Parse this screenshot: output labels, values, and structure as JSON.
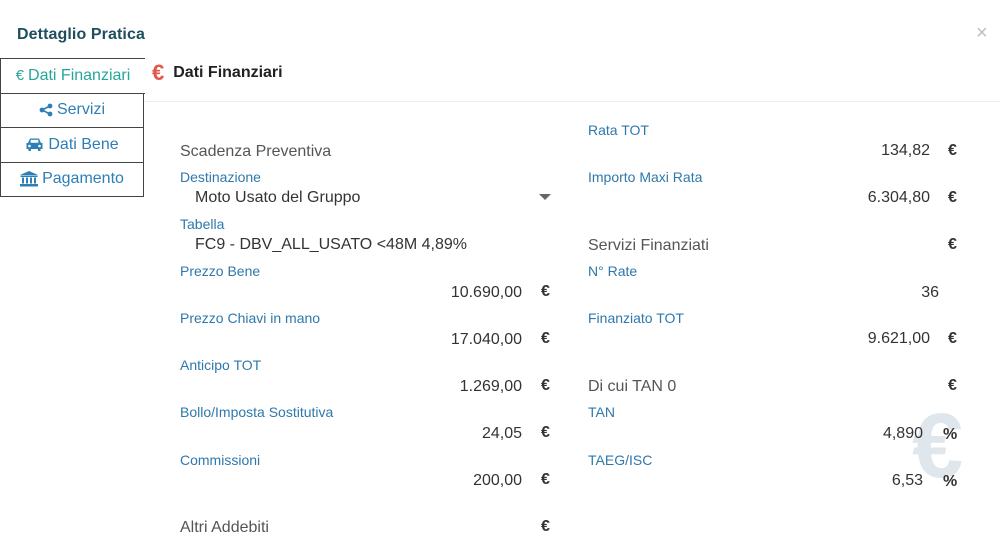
{
  "header": {
    "title": "Dettaglio Pratica",
    "close": "×"
  },
  "nav": [
    {
      "label": "Dati Finanziari",
      "icon": "€"
    },
    {
      "label": "Servizi",
      "icon": "share-icon"
    },
    {
      "label": "Dati Bene",
      "icon": "car-icon"
    },
    {
      "label": "Pagamento",
      "icon": "bank-icon"
    }
  ],
  "section": {
    "icon": "€",
    "title": "Dati Finanziari"
  },
  "left": {
    "scadenza": "Scadenza Preventiva",
    "destinazione": {
      "label": "Destinazione",
      "value": "Moto Usato del Gruppo"
    },
    "tabella": {
      "label": "Tabella",
      "value": "FC9 - DBV_ALL_USATO <48M 4,89%"
    },
    "prezzo_bene": {
      "label": "Prezzo Bene",
      "value": "10.690,00",
      "unit": "€"
    },
    "prezzo_chiavi": {
      "label": "Prezzo Chiavi in mano",
      "value": "17.040,00",
      "unit": "€"
    },
    "anticipo": {
      "label": "Anticipo TOT",
      "value": "1.269,00",
      "unit": "€"
    },
    "bollo": {
      "label": "Bollo/Imposta Sostitutiva",
      "value": "24,05",
      "unit": "€"
    },
    "commissioni": {
      "label": "Commissioni",
      "value": "200,00",
      "unit": "€"
    },
    "altri": {
      "label": "Altri Addebiti",
      "unit": "€"
    }
  },
  "right": {
    "rata_tot": {
      "label": "Rata TOT",
      "value": "134,82",
      "unit": "€"
    },
    "maxi_rata": {
      "label": "Importo Maxi Rata",
      "value": "6.304,80",
      "unit": "€"
    },
    "servizi_fin": {
      "label": "Servizi Finanziati",
      "unit": "€"
    },
    "n_rate": {
      "label": "N° Rate",
      "value": "36"
    },
    "finanziato": {
      "label": "Finanziato TOT",
      "value": "9.621,00",
      "unit": "€"
    },
    "tan0": {
      "label": "Di cui TAN 0",
      "unit": "€"
    },
    "tan": {
      "label": "TAN",
      "value": "4,890",
      "unit": "%"
    },
    "taeg": {
      "label": "TAEG/ISC",
      "value": "6,53",
      "unit": "%"
    }
  },
  "watermark": "€",
  "colors": {
    "title": "#1f4e5f",
    "label": "#2f78ab",
    "active_nav": "#26a69a",
    "nav": "#2d7fb5",
    "euro_icon": "#e2574c"
  }
}
